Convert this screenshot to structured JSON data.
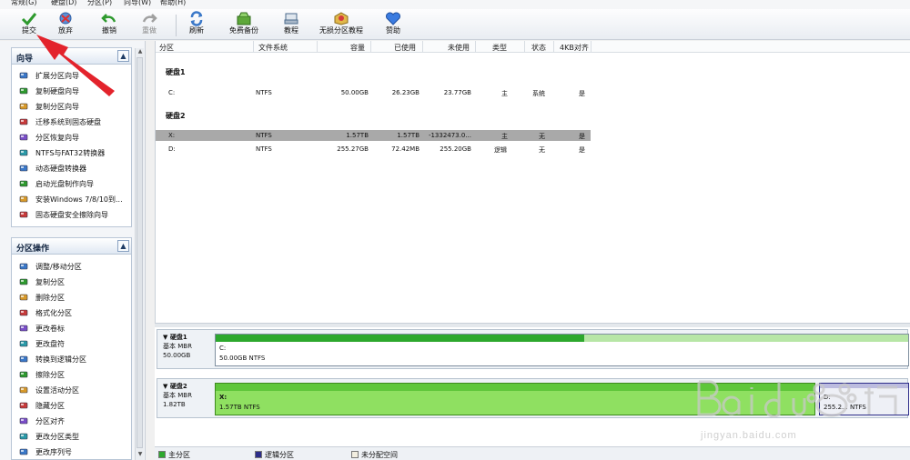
{
  "menu": [
    "常规(G)",
    "硬盘(D)",
    "分区(P)",
    "向导(W)",
    "帮助(H)"
  ],
  "toolbar": {
    "submit": "提交",
    "discard": "放弃",
    "undo": "撤销",
    "redo": "重做",
    "refresh": "刷新",
    "free_backup": "免费备份",
    "tutorial": "教程",
    "lossless_tutorial": "无损分区教程",
    "sponsor": "赞助"
  },
  "wizard_panel": {
    "title": "向导",
    "items": [
      {
        "label": "扩展分区向导",
        "icon": "extend-wizard-icon"
      },
      {
        "label": "复制硬盘向导",
        "icon": "copy-disk-icon"
      },
      {
        "label": "复制分区向导",
        "icon": "copy-partition-icon"
      },
      {
        "label": "迁移系统到固态硬盘",
        "icon": "migrate-ssd-icon"
      },
      {
        "label": "分区恢复向导",
        "icon": "recovery-icon"
      },
      {
        "label": "NTFS与FAT32转换器",
        "icon": "convert-icon"
      },
      {
        "label": "动态硬盘转换器",
        "icon": "dynamic-disk-icon"
      },
      {
        "label": "启动光盘制作向导",
        "icon": "boot-cd-icon"
      },
      {
        "label": "安装Windows 7/8/10到...",
        "icon": "windows-icon"
      },
      {
        "label": "固态硬盘安全擦除向导",
        "icon": "ssd-erase-icon"
      }
    ]
  },
  "partition_panel": {
    "title": "分区操作",
    "items": [
      {
        "label": "调整/移动分区",
        "icon": "resize-icon"
      },
      {
        "label": "复制分区",
        "icon": "copy-icon"
      },
      {
        "label": "删除分区",
        "icon": "delete-icon"
      },
      {
        "label": "格式化分区",
        "icon": "format-icon"
      },
      {
        "label": "更改卷标",
        "icon": "label-icon"
      },
      {
        "label": "更改盘符",
        "icon": "drive-letter-icon"
      },
      {
        "label": "转换到逻辑分区",
        "icon": "logical-icon"
      },
      {
        "label": "擦除分区",
        "icon": "wipe-icon"
      },
      {
        "label": "设置活动分区",
        "icon": "active-icon"
      },
      {
        "label": "隐藏分区",
        "icon": "hide-icon"
      },
      {
        "label": "分区对齐",
        "icon": "align-icon"
      },
      {
        "label": "更改分区类型",
        "icon": "type-icon"
      },
      {
        "label": "更改序列号",
        "icon": "serial-icon"
      }
    ]
  },
  "table": {
    "headers": [
      "分区",
      "文件系统",
      "容量",
      "已使用",
      "未使用",
      "类型",
      "状态",
      "4KB对齐"
    ],
    "disk1": {
      "title": "硬盘1",
      "rows": [
        {
          "partition": "C:",
          "fs": "NTFS",
          "capacity": "50.00GB",
          "used": "26.23GB",
          "free": "23.77GB",
          "type": "主",
          "status": "系统",
          "align": "是"
        }
      ]
    },
    "disk2": {
      "title": "硬盘2",
      "rows": [
        {
          "partition": "X:",
          "fs": "NTFS",
          "capacity": "1.57TB",
          "used": "1.57TB",
          "free": "-1332473.0...",
          "type": "主",
          "status": "无",
          "align": "是"
        },
        {
          "partition": "D:",
          "fs": "NTFS",
          "capacity": "255.27GB",
          "used": "72.42MB",
          "free": "255.20GB",
          "type": "逻辑",
          "status": "无",
          "align": "是"
        }
      ]
    }
  },
  "diskmap": {
    "disk1": {
      "name": "硬盘1",
      "kind": "基本 MBR",
      "size": "50.00GB",
      "part_letter": "C:",
      "part_desc": "50.00GB NTFS"
    },
    "disk2": {
      "name": "硬盘2",
      "kind": "基本 MBR",
      "size": "1.82TB",
      "part_letter": "X:",
      "part_desc": "1.57TB NTFS",
      "part2_letter": "D:",
      "part2_desc": "255.2... NTFS"
    }
  },
  "legend": {
    "primary": "主分区",
    "logical": "逻辑分区",
    "unallocated": "未分配空间"
  },
  "colors": {
    "primary": "#2da82d",
    "logical": "#2d2d8a",
    "unallocated": "#f2eee0",
    "arrow": "#e3232c"
  }
}
